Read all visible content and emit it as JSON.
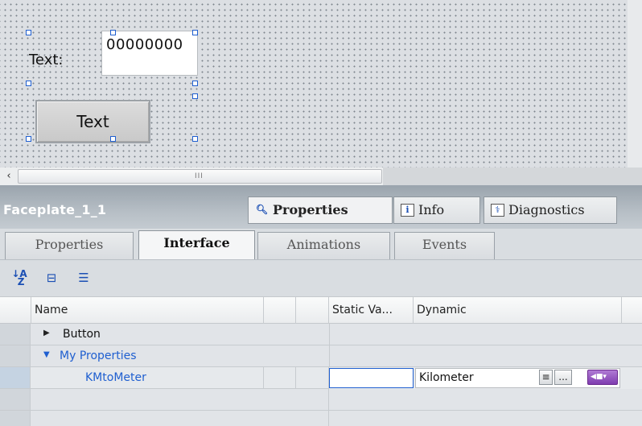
{
  "canvas": {
    "label_text": "Text:",
    "io_field_value": "00000000",
    "button_text": "Text"
  },
  "scrollbar": {
    "grip": "III"
  },
  "inspector": {
    "title": "Faceplate_1_1",
    "tabs": [
      {
        "label": "Properties",
        "icon": "properties-icon",
        "active": true
      },
      {
        "label": "Info",
        "icon": "info-icon",
        "active": false
      },
      {
        "label": "Diagnostics",
        "icon": "diagnostics-icon",
        "active": false
      }
    ]
  },
  "subtabs": [
    {
      "label": "Properties",
      "active": false
    },
    {
      "label": "Interface",
      "active": true
    },
    {
      "label": "Animations",
      "active": false
    },
    {
      "label": "Events",
      "active": false
    }
  ],
  "toolbar": {
    "icons": [
      "sort-ascending-icon",
      "collapse-icon",
      "expand-list-icon"
    ]
  },
  "table": {
    "headers": {
      "name": "Name",
      "static_value": "Static Va...",
      "dynamic": "Dynamic"
    },
    "rows": [
      {
        "name": "Button",
        "expanded": false,
        "type": "group"
      },
      {
        "name": "My Properties",
        "expanded": true,
        "type": "group"
      },
      {
        "name": "KMtoMeter",
        "type": "property",
        "static_value": "",
        "dynamic_value": "Kilometer"
      }
    ],
    "dynamic_buttons": {
      "list": "list-icon",
      "more": "...",
      "tag": "tag-icon"
    }
  },
  "colors": {
    "link_blue": "#1f5fd0",
    "selection_handle": "#1f5fd0",
    "inspector_bar": "#a9b2ba"
  }
}
